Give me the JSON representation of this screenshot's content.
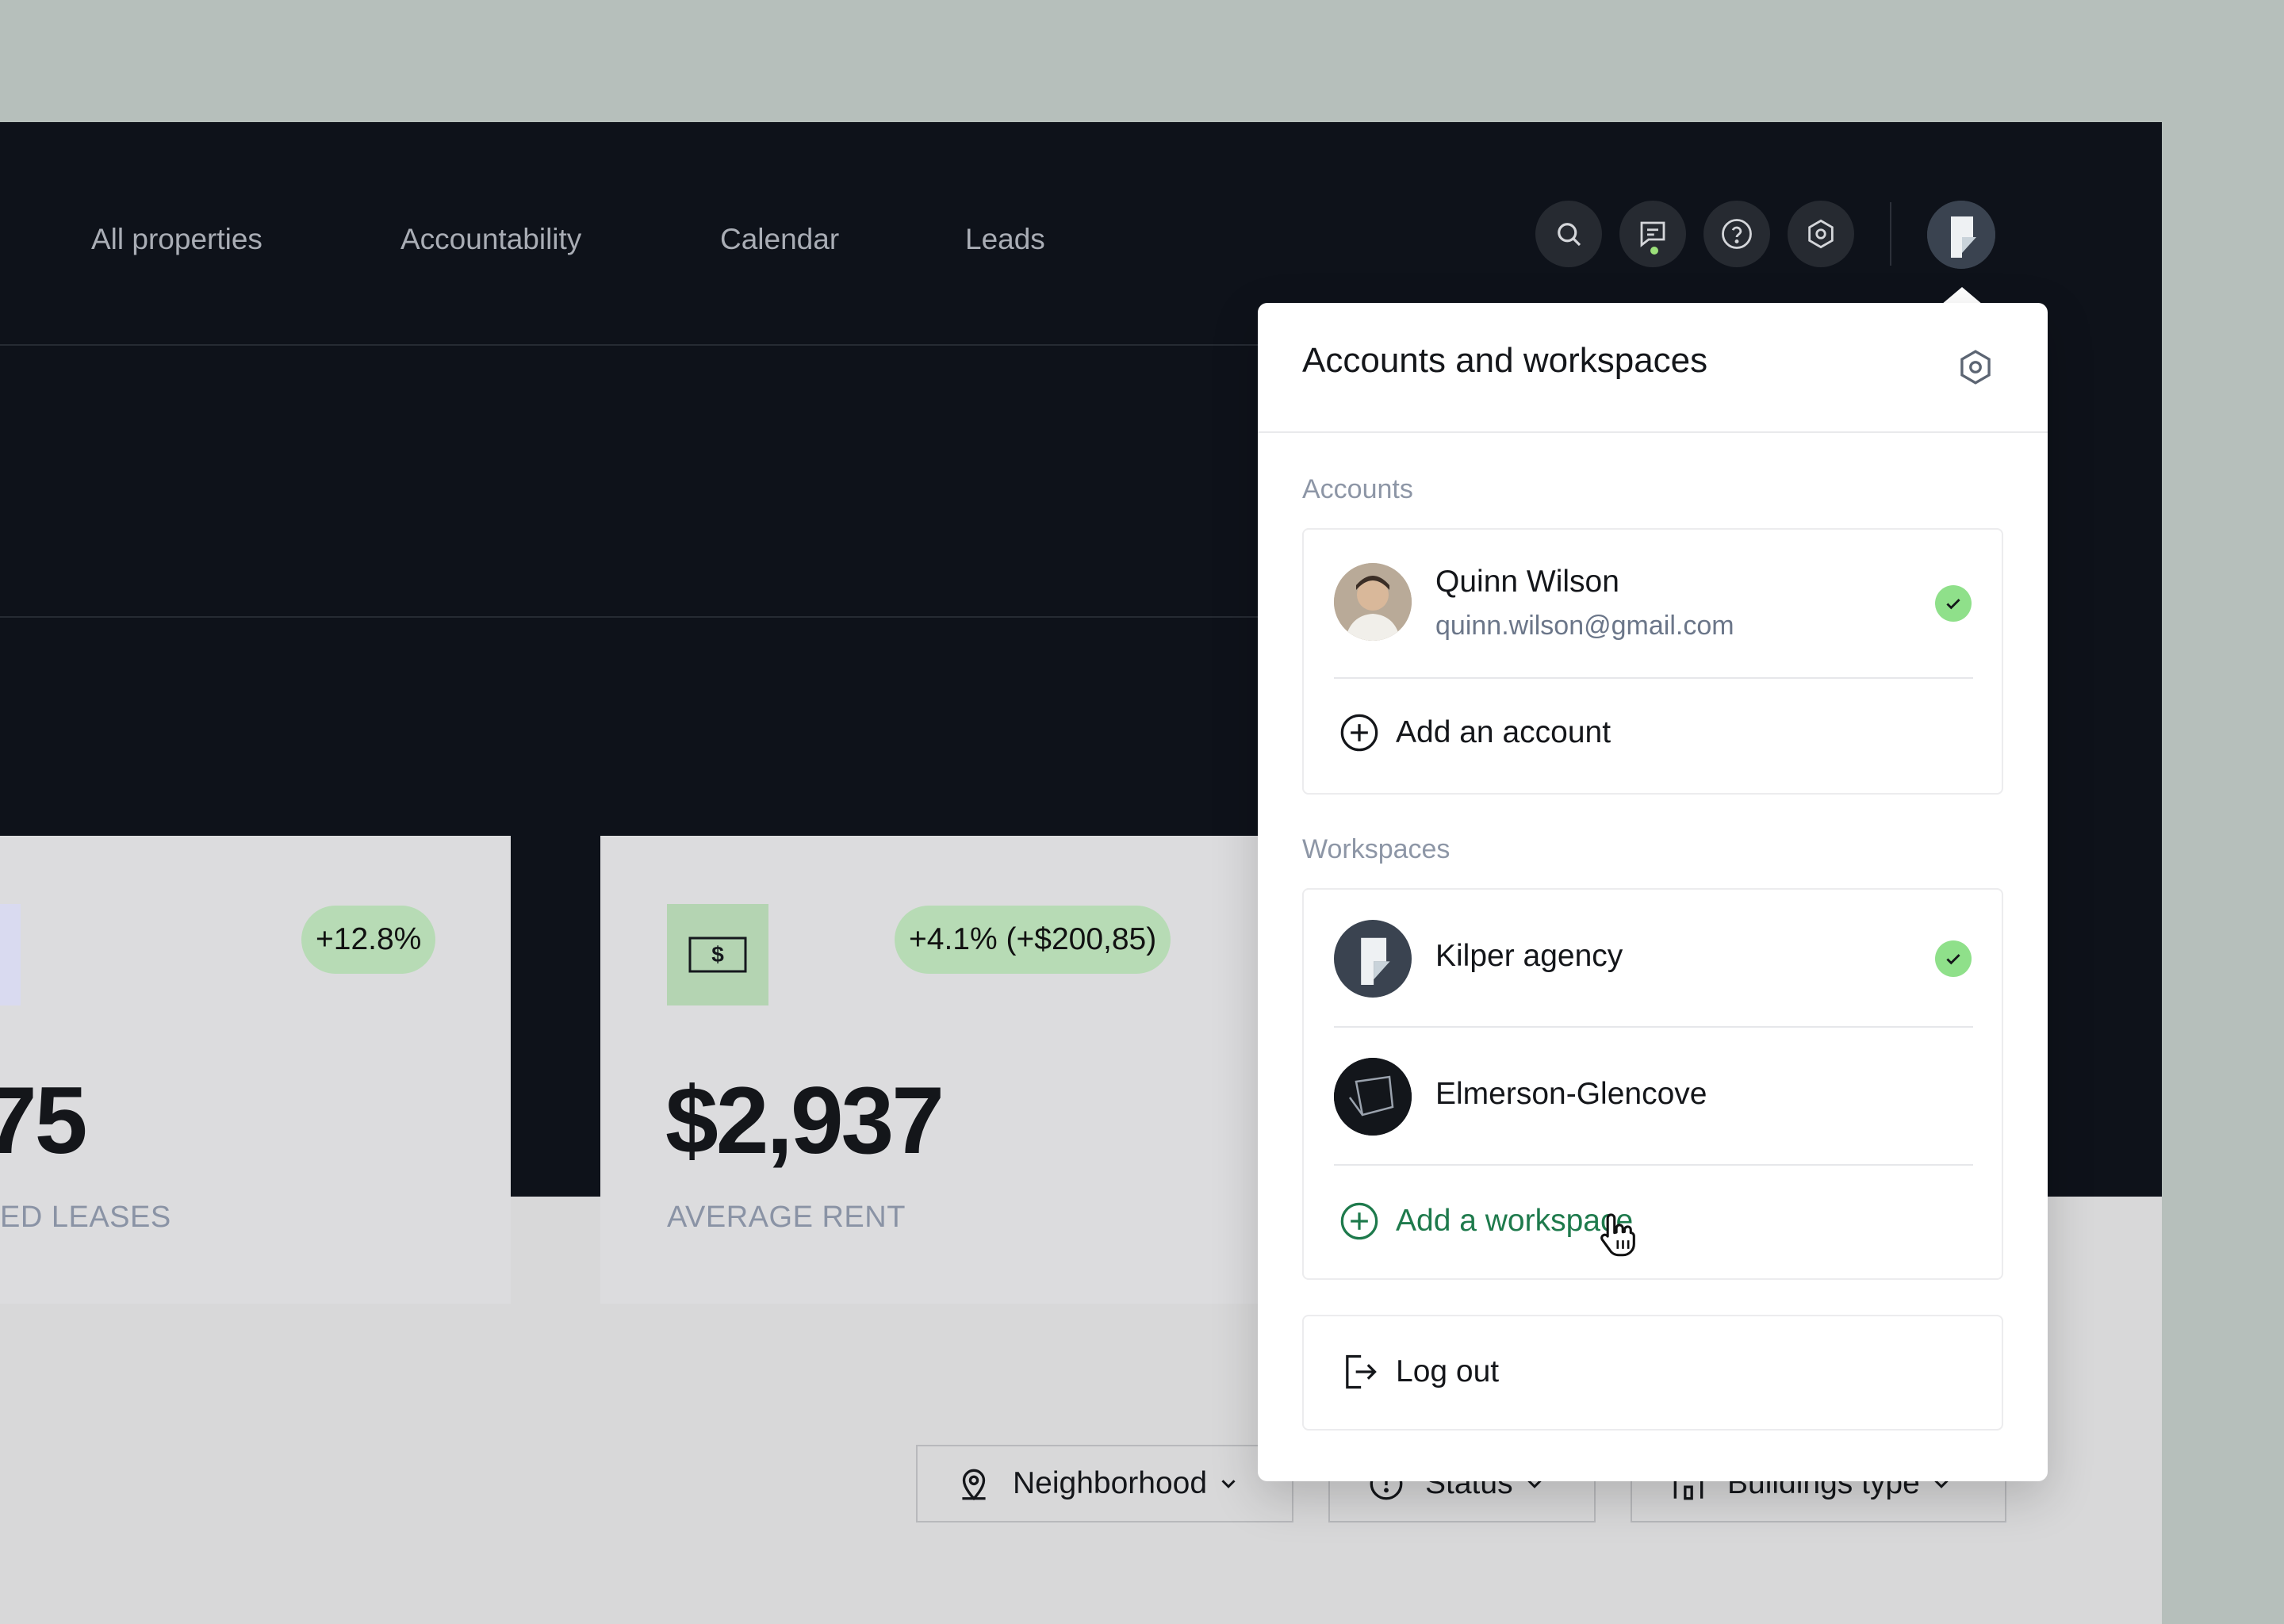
{
  "nav": {
    "links": [
      "All properties",
      "Accountability",
      "Calendar",
      "Leads"
    ],
    "icons": [
      "search-icon",
      "chat-icon",
      "help-icon",
      "settings-icon"
    ],
    "notification_color": "#9be07a"
  },
  "stats": [
    {
      "badge": "+12.8%",
      "value": "75",
      "caption": "ED LEASES"
    },
    {
      "badge": "+4.1% (+$200,85)",
      "value": "$2,937",
      "caption": "AVERAGE RENT"
    }
  ],
  "filters": [
    {
      "label": "Neighborhood",
      "icon": "map-pin-icon"
    },
    {
      "label": "Status",
      "icon": "status-icon"
    },
    {
      "label": "Buildings type",
      "icon": "building-icon"
    }
  ],
  "popover": {
    "title": "Accounts and workspaces",
    "accounts_label": "Accounts",
    "account": {
      "name": "Quinn Wilson",
      "email": "quinn.wilson@gmail.com"
    },
    "add_account": "Add an account",
    "workspaces_label": "Workspaces",
    "workspaces": [
      {
        "name": "Kilper agency",
        "selected": true
      },
      {
        "name": "Elmerson-Glencove",
        "selected": false
      }
    ],
    "add_workspace": "Add a workspace",
    "logout": "Log out"
  },
  "colors": {
    "background": "#b6bfbb",
    "dark_header": "#0e121a",
    "accent_green": "#1e7a4c",
    "badge_green": "#b7dbb5",
    "check_green": "#8fe08a"
  }
}
